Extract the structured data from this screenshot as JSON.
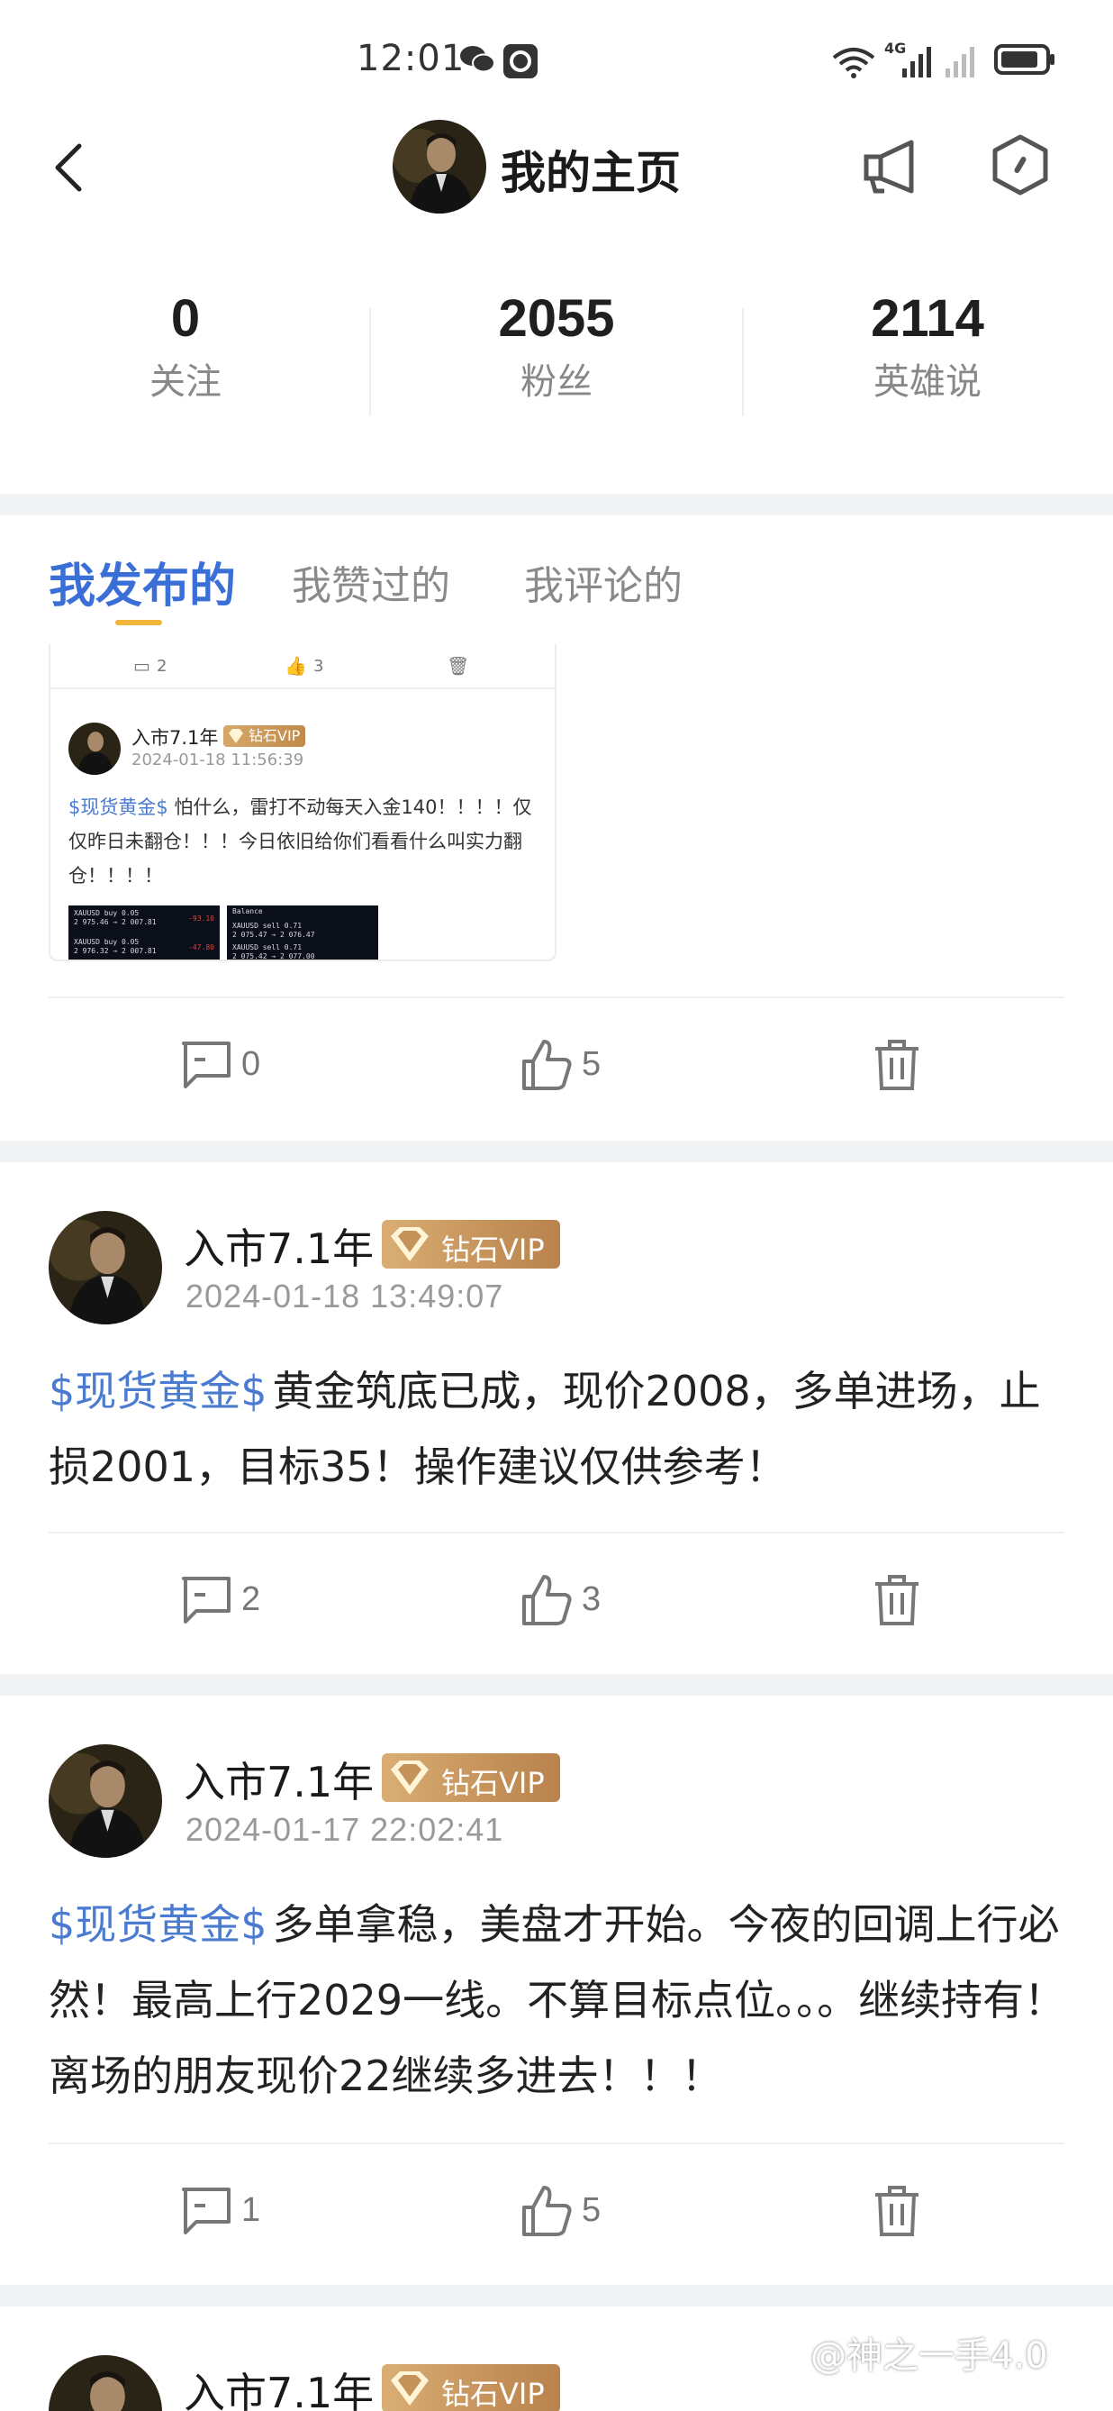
{
  "status_bar": {
    "time": "12:01",
    "network": "4G"
  },
  "header": {
    "title": "我的主页"
  },
  "stats": [
    {
      "value": "0",
      "label": "关注"
    },
    {
      "value": "2055",
      "label": "粉丝"
    },
    {
      "value": "2114",
      "label": "英雄说"
    }
  ],
  "tabs": [
    {
      "label": "我发布的",
      "active": true
    },
    {
      "label": "我赞过的",
      "active": false
    },
    {
      "label": "我评论的",
      "active": false
    }
  ],
  "embedded_post": {
    "comments": "2",
    "likes": "3",
    "author": "入市7.1年",
    "badge": "钻石VIP",
    "date": "2024-01-18 11:56:39",
    "tag": "$现货黄金$",
    "text": "怕什么，雷打不动每天入金140！！！！仅仅昨日未翻仓！！！今日依旧给你们看看什么叫实力翻仓！！！！",
    "img1_rows": [
      "XAUUSD buy 0.05",
      "2 975.46 → 2 007.81",
      "XAUUSD buy 0.05",
      "2 976.32 → 2 007.81"
    ],
    "img1_values": [
      "-93.10",
      "-47.80"
    ],
    "img2_rows": [
      "Balance",
      "XAUUSD sell 0.71",
      "2 075.47 → 2 076.47",
      "XAUUSD sell 0.71",
      "2 075.42 → 2 077.00"
    ]
  },
  "post0_actions": {
    "comments": "0",
    "likes": "5"
  },
  "posts": [
    {
      "author": "入市7.1年",
      "badge": "钻石VIP",
      "date": "2024-01-18 13:49:07",
      "tag": "$现货黄金$",
      "text": "黄金筑底已成，现价2008，多单进场，止损2001，目标35！操作建议仅供参考！",
      "comments": "2",
      "likes": "3"
    },
    {
      "author": "入市7.1年",
      "badge": "钻石VIP",
      "date": "2024-01-17 22:02:41",
      "tag": "$现货黄金$",
      "text": "多单拿稳，美盘才开始。今夜的回调上行必然！最高上行2029一线。不算目标点位。。。继续持有！离场的朋友现价22继续多进去！！！",
      "comments": "1",
      "likes": "5"
    },
    {
      "author": "入市7.1年",
      "badge": "钻石VIP"
    }
  ],
  "watermark": "@神之一手4.0",
  "colors": {
    "accent": "#3a6fd8",
    "tag": "#4a7bd0",
    "tab_indicator": "#f0b63a",
    "vip_gold": "#c5925a"
  }
}
